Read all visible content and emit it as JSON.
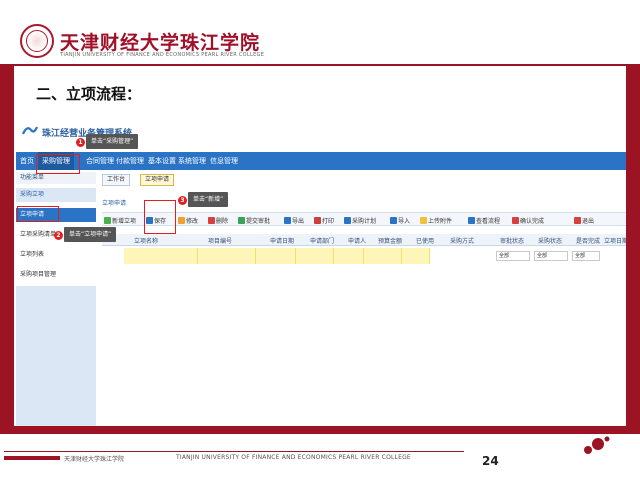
{
  "header": {
    "university_name": "天津财经大学珠江学院",
    "university_sub": "TIANJIN UNIVERSITY OF FINANCE AND ECONOMICS PEARL RIVER COLLEGE"
  },
  "section_title": "二、立项流程：",
  "app": {
    "title": "珠江经营业务管理系统",
    "nav": [
      "首页",
      "采购管理",
      "合同管理",
      "付款管理",
      "基本设置",
      "系统管理",
      "信息管理"
    ],
    "sidebar": {
      "header": "功能菜单",
      "group": "采购立项",
      "items": [
        "立项申请",
        "立项采购清单",
        "立项列表",
        "采购项目管理"
      ]
    },
    "tabs": [
      "工作台",
      "立项申请"
    ],
    "panel_title": "立项申请",
    "toolbar": [
      "新增立项",
      "保存",
      "修改",
      "删除",
      "提交审批",
      "导出",
      "打印",
      "采购计划",
      "导入",
      "上传附件",
      "查看流程",
      "确认完成",
      "退出"
    ],
    "grid_headers": [
      "立项名称",
      "项目编号",
      "申请日期",
      "申请部门",
      "申请人",
      "预算金额",
      "已使用",
      "采购方式",
      "审批状态",
      "采购状态",
      "是否完成",
      "立项日期"
    ],
    "filter_values": [
      "全部",
      "全部",
      "全部"
    ]
  },
  "callouts": {
    "c1": "单击“采购管理”",
    "c2": "单击“立项申请”",
    "c3": "单击“新增”"
  },
  "badges": [
    "1",
    "2",
    "3"
  ],
  "footer": {
    "cn": "天津财经大学珠江学院",
    "en": "TIANJIN UNIVERSITY OF FINANCE AND ECONOMICS PEARL RIVER COLLEGE",
    "page": "24"
  },
  "colors": {
    "brand_maroon": "#9c1424",
    "nav_blue": "#2b73c4",
    "highlight_red": "#e02020",
    "filter_yellow": "#fdf6b8"
  }
}
